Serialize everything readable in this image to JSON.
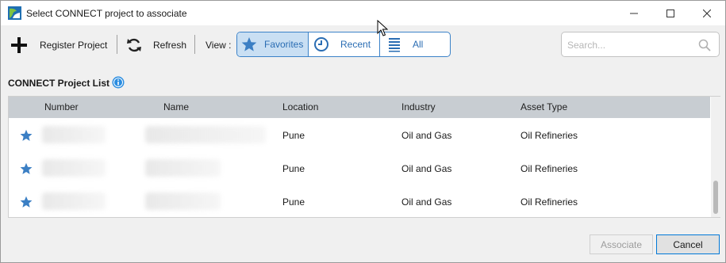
{
  "window": {
    "title": "Select CONNECT project to associate",
    "icon": "connect-app-icon"
  },
  "toolbar": {
    "register_label": "Register Project",
    "refresh_label": "Refresh",
    "view_label": "View :",
    "views": [
      {
        "label": "Favorites",
        "icon": "star-icon",
        "active": true
      },
      {
        "label": "Recent",
        "icon": "clock-icon",
        "active": false
      },
      {
        "label": "All",
        "icon": "list-icon",
        "active": false
      }
    ],
    "search_placeholder": "Search..."
  },
  "section": {
    "title": "CONNECT Project List",
    "info_icon": "info-icon"
  },
  "table": {
    "columns": [
      "Number",
      "Name",
      "Location",
      "Industry",
      "Asset Type"
    ],
    "rows": [
      {
        "favorite": true,
        "number": "",
        "name": "",
        "location": "Pune",
        "industry": "Oil and Gas",
        "asset_type": "Oil Refineries"
      },
      {
        "favorite": true,
        "number": "",
        "name": "",
        "location": "Pune",
        "industry": "Oil and Gas",
        "asset_type": "Oil Refineries"
      },
      {
        "favorite": true,
        "number": "",
        "name": "",
        "location": "Pune",
        "industry": "Oil and Gas",
        "asset_type": "Oil Refineries"
      }
    ]
  },
  "footer": {
    "associate_label": "Associate",
    "cancel_label": "Cancel"
  },
  "colors": {
    "accent": "#2a6db3",
    "star": "#3b7fc4",
    "header_bg": "#c8cdd2",
    "active_view_bg": "#c9dff3"
  }
}
